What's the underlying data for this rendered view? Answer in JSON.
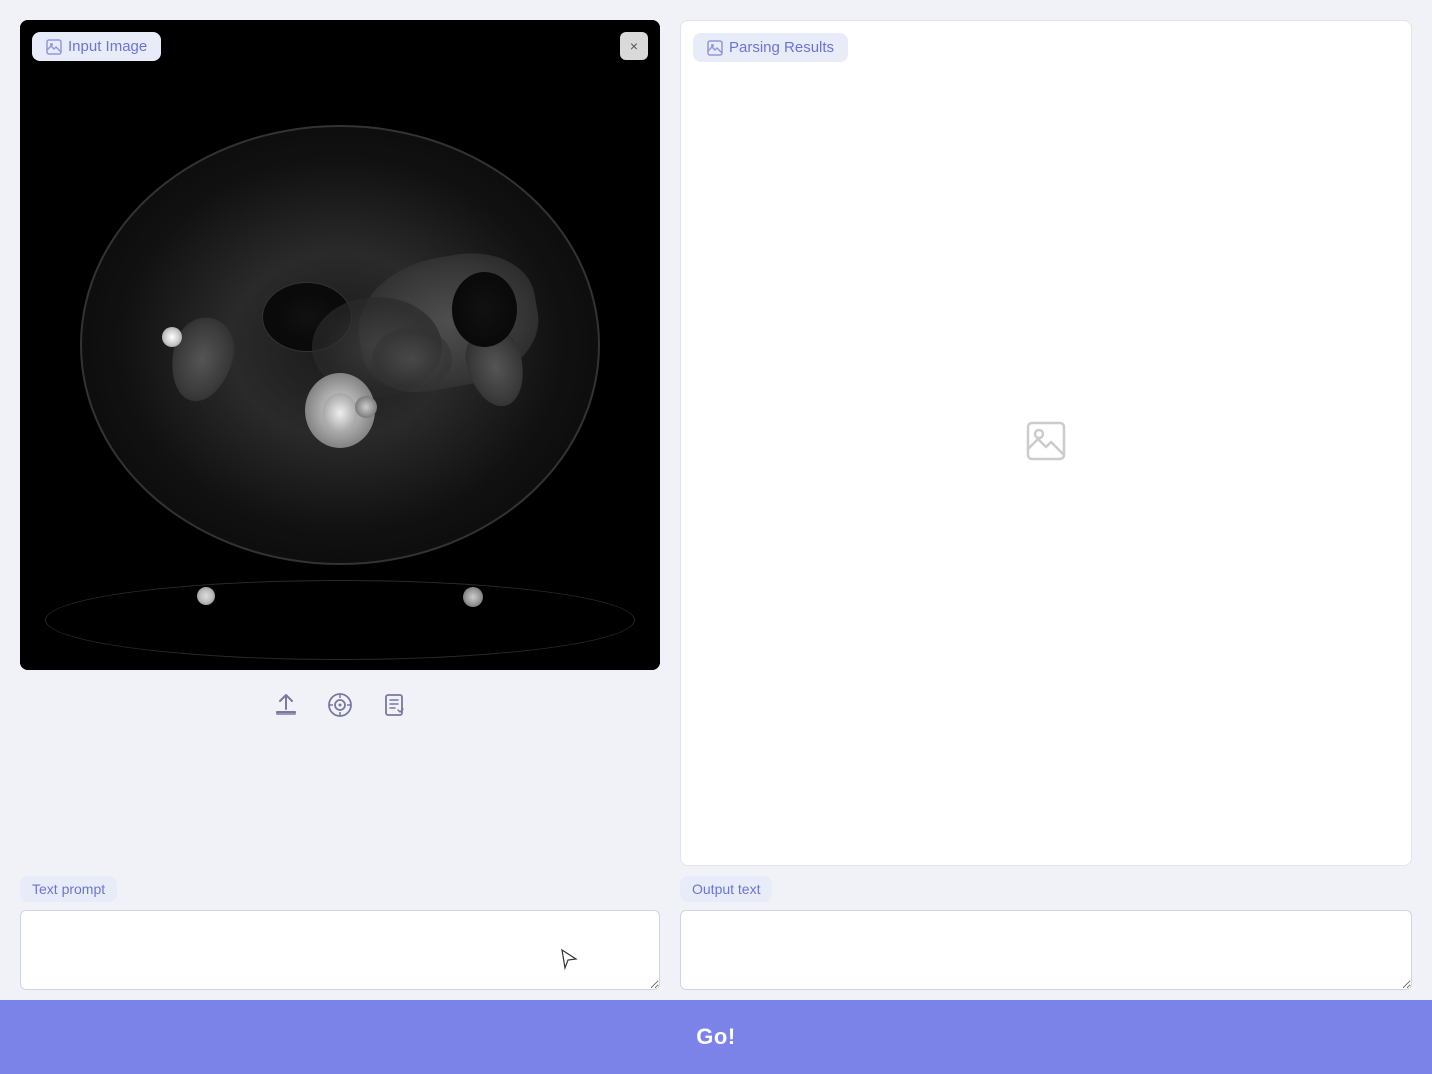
{
  "header": {
    "input_image_label": "Input Image",
    "parsing_results_label": "Parsing Results",
    "close_button_label": "×"
  },
  "toolbar": {
    "upload_tooltip": "Upload",
    "camera_tooltip": "Camera",
    "document_tooltip": "Document scan"
  },
  "bottom": {
    "text_prompt_label": "Text prompt",
    "text_prompt_placeholder": "",
    "output_text_label": "Output text",
    "output_text_placeholder": ""
  },
  "go_button": {
    "label": "Go!"
  },
  "icons": {
    "image_icon": "🖼",
    "upload_icon": "⬆",
    "camera_icon": "⊙",
    "document_icon": "📋"
  },
  "colors": {
    "accent": "#6b75d6",
    "label_bg": "#e8ecf8",
    "button_bg": "#7b82e8",
    "bg": "#f0f2f8"
  }
}
